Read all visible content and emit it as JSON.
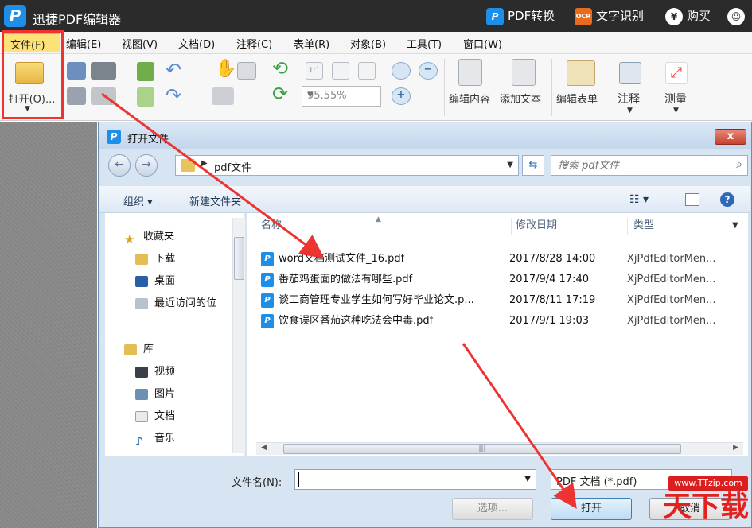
{
  "app": {
    "title": "迅捷PDF编辑器",
    "logo_letter": "P",
    "top_actions": [
      "PDF转换",
      "文字识别",
      "购买"
    ]
  },
  "menu": [
    "文件(F)",
    "编辑(E)",
    "视图(V)",
    "文档(D)",
    "注释(C)",
    "表单(R)",
    "对象(B)",
    "工具(T)",
    "窗口(W)"
  ],
  "ribbon": {
    "open_label": "打开(O)...",
    "zoom_value": "95.55%",
    "edit_content": "编辑内容",
    "add_text": "添加文本",
    "edit_form": "编辑表单",
    "annotate": "注释",
    "measure": "测量"
  },
  "dialog": {
    "title": "打开文件",
    "close": "x",
    "path": "pdf文件",
    "search_placeholder": "搜索 pdf文件",
    "organize": "组织 ▾",
    "new_folder": "新建文件夹",
    "nav": {
      "favorites": "收藏夹",
      "downloads": "下载",
      "desktop": "桌面",
      "recent": "最近访问的位",
      "library": "库",
      "videos": "视频",
      "pictures": "图片",
      "documents": "文档",
      "music": "音乐"
    },
    "columns": {
      "name": "名称",
      "modified": "修改日期",
      "type": "类型"
    },
    "files": [
      {
        "name": "word文档测试文件_16.pdf",
        "date": "2017/8/28 14:00",
        "type": "XjPdfEditorMen..."
      },
      {
        "name": "番茄鸡蛋面的做法有哪些.pdf",
        "date": "2017/9/4 17:40",
        "type": "XjPdfEditorMen..."
      },
      {
        "name": "谈工商管理专业学生如何写好毕业论文.p...",
        "date": "2017/8/11 17:19",
        "type": "XjPdfEditorMen..."
      },
      {
        "name": "饮食误区番茄这种吃法会中毒.pdf",
        "date": "2017/9/1 19:03",
        "type": "XjPdfEditorMen..."
      }
    ],
    "filename_label": "文件名(N):",
    "filename_value": "",
    "filter": "PDF 文档 (*.pdf)",
    "options_btn": "选项...",
    "open_btn": "打开",
    "cancel_btn": "取消"
  },
  "watermark": {
    "site": "www.TTzip.com",
    "text": "天下载"
  }
}
